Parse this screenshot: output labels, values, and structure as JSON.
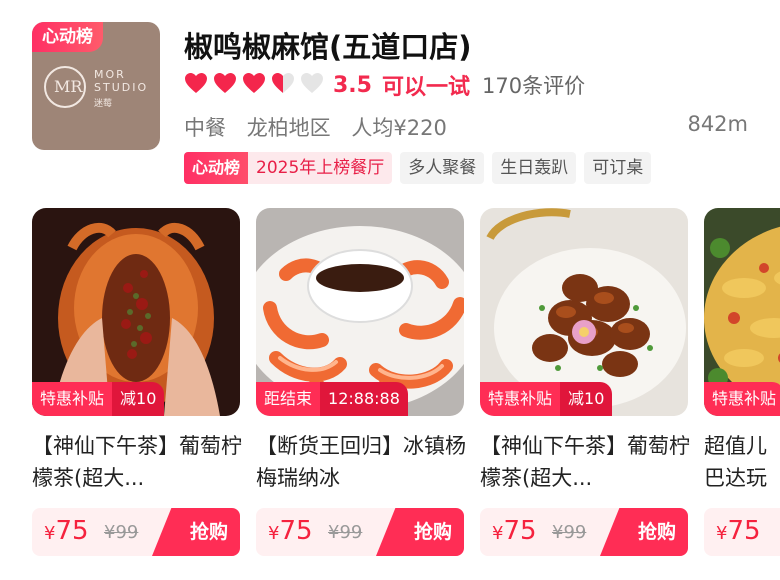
{
  "restaurant": {
    "logo_tag": "心动榜",
    "logo_text_line1": "MOR",
    "logo_text_line2": "STUDIO",
    "logo_sub": "迷莓",
    "logo_mark": "MR",
    "title": "椒鸣椒麻馆(五道口店)",
    "rating": {
      "hearts": 3.5,
      "hearts_total": 5,
      "score": "3.5",
      "verdict": "可以一试",
      "reviews": "170条评价"
    },
    "cuisine": "中餐",
    "area": "龙柏地区",
    "avg_price": "人均¥220",
    "distance": "842m",
    "rank_tag_logo": "心动榜",
    "rank_tag_text": "2025年上榜餐厅",
    "tags": [
      "多人聚餐",
      "生日轰趴",
      "可订桌"
    ]
  },
  "colors": {
    "accent": "#ff2d55",
    "accent_dark": "#e0163b",
    "price": "#f5223e",
    "heart_full": "#f4264c",
    "heart_empty": "#e5e5e5"
  },
  "deals": [
    {
      "photo": "roast-chicken-photo",
      "badge_a": "特惠补贴",
      "badge_b": "减10",
      "title": "【神仙下午茶】葡萄柠檬茶(超大...",
      "price_symbol": "¥",
      "price": "75",
      "original_price": "¥99",
      "buy_label": "抢购"
    },
    {
      "photo": "shrimp-platter-photo",
      "badge_a": "距结束",
      "badge_b": "12:88:88",
      "title": "【断货王回归】冰镇杨梅瑞纳冰",
      "price_symbol": "¥",
      "price": "75",
      "original_price": "¥99",
      "buy_label": "抢购"
    },
    {
      "photo": "sweet-sour-pork-photo",
      "badge_a": "特惠补贴",
      "badge_b": "减10",
      "title": "【神仙下午茶】葡萄柠檬茶(超大...",
      "price_symbol": "¥",
      "price": "75",
      "original_price": "¥99",
      "buy_label": "抢购"
    },
    {
      "photo": "fried-dish-photo",
      "badge_a": "特惠补贴",
      "badge_b": "",
      "title": "超值儿巴达玩",
      "price_symbol": "¥",
      "price": "75",
      "original_price": "",
      "buy_label": ""
    }
  ]
}
